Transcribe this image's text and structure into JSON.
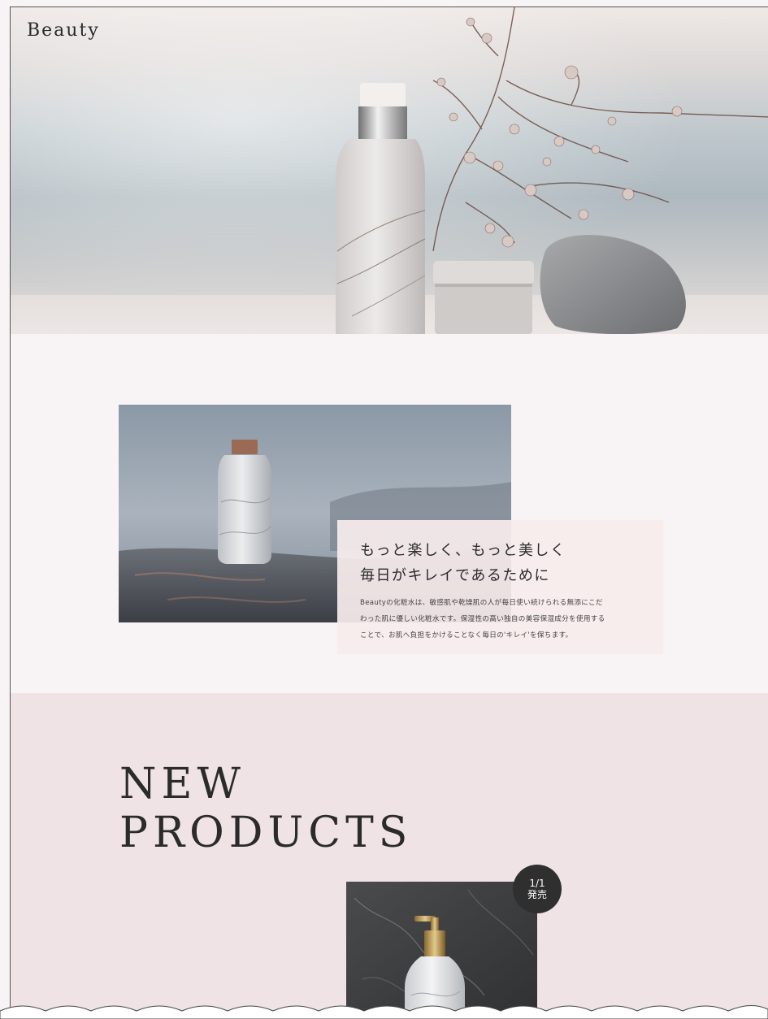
{
  "header": {
    "brand": "Beauty"
  },
  "intro": {
    "heading_line1": "もっと楽しく、もっと美しく",
    "heading_line2": "毎日がキレイであるために",
    "body_line1": "Beautyの化粧水は、敏感肌や乾燥肌の人が毎日使い続けられる無添にこだ",
    "body_line2": "わった肌に優しい化粧水です。保湿性の高い独自の美容保湿成分を使用する",
    "body_line3": "ことで、お肌へ負担をかけることなく毎日の'キレイ'を保ちます。"
  },
  "products": {
    "title_line1": "NEW",
    "title_line2": "PRODUCTS",
    "badge_line1": "1/1",
    "badge_line2": "発売"
  },
  "colors": {
    "page_background": "#f8f3f4",
    "products_background": "#efe3e5",
    "card_background": "#f6ecec",
    "badge": "#2f2f2f",
    "text": "#2b2b2b"
  },
  "icons": [
    "brand-wordmark",
    "hero-photo",
    "product-photo",
    "release-badge"
  ]
}
